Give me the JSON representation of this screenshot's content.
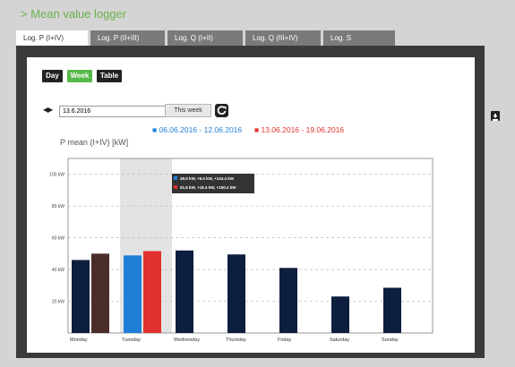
{
  "app": {
    "title": "> Mean value logger"
  },
  "tabs": [
    {
      "label": "Log. P (I+IV)",
      "active": true
    },
    {
      "label": "Log. P (II+III)",
      "active": false
    },
    {
      "label": "Log. Q (I+II)",
      "active": false
    },
    {
      "label": "Log. Q (III+IV)",
      "active": false
    },
    {
      "label": "Log. S",
      "active": false
    }
  ],
  "view_buttons": [
    {
      "label": "Day",
      "color": "#222222"
    },
    {
      "label": "Week",
      "color": "#56b848",
      "active": true
    },
    {
      "label": "Table",
      "color": "#222222"
    }
  ],
  "date": {
    "value": "13.6.2016",
    "this_week_label": "This week"
  },
  "icons": {
    "nav": "prev-next-arrows-icon",
    "refresh": "refresh-icon",
    "download": "download-icon"
  },
  "chart_data": {
    "type": "bar",
    "title": "P mean (I+IV) [kW]",
    "legend": [
      {
        "marker": "■",
        "label": "06.06.2016 - 12.06.2016",
        "color": "#1f7fd6"
      },
      {
        "marker": "■",
        "label": "13.06.2016 - 19.06.2016",
        "color": "#e0322e"
      }
    ],
    "categories": [
      "Monday",
      "Tuesday",
      "Wednesday",
      "Thursday",
      "Friday",
      "Saturday",
      "Sunday"
    ],
    "series": [
      {
        "name": "06.06.2016 - 12.06.2016",
        "values": [
          46,
          48.9,
          52,
          49.5,
          41,
          23,
          28.5
        ],
        "colors": [
          "#0e1e3e",
          "#1f7fd6",
          "#0e1e3e",
          "#0e1e3e",
          "#0e1e3e",
          "#0e1e3e",
          "#0e1e3e"
        ]
      },
      {
        "name": "13.06.2016 - 19.06.2016",
        "values": [
          50,
          51.6,
          null,
          null,
          null,
          null,
          null
        ],
        "colors": [
          "#4a2c2a",
          "#e0322e",
          null,
          null,
          null,
          null,
          null
        ]
      }
    ],
    "y_ticks": [
      "100 kW",
      "80 kW",
      "60 kW",
      "40 kW",
      "20 kW"
    ],
    "y_tick_values": [
      100,
      80,
      60,
      40,
      20
    ],
    "ylim": [
      0,
      110
    ],
    "highlight_category": "Tuesday",
    "tooltip": [
      {
        "text": "48.9 kW, +6.0 kW, +144.4 kW",
        "color": "#1f7fd6"
      },
      {
        "text": "51.6 kW, +18.4 kW, +150.2 kW",
        "color": "#e0322e"
      }
    ]
  }
}
